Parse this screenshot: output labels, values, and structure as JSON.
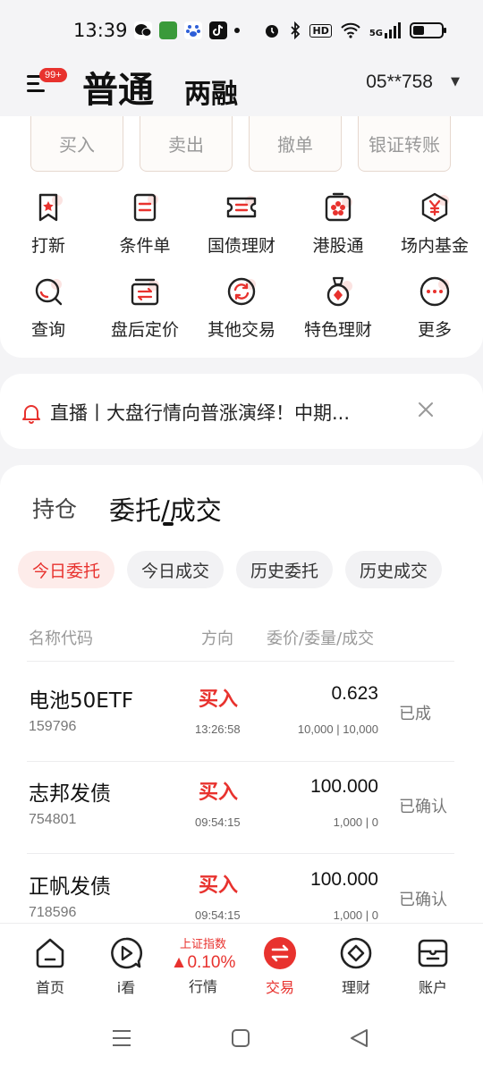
{
  "status_bar": {
    "time": "13:39",
    "network": "5G",
    "hd": "HD"
  },
  "header": {
    "badge": "99+",
    "tab_normal": "普通",
    "tab_margin": "两融",
    "account": "05**758"
  },
  "actions": [
    "买入",
    "卖出",
    "撤单",
    "银证转账"
  ],
  "grid": [
    {
      "label": "打新",
      "icon": "bookmark-star-icon"
    },
    {
      "label": "条件单",
      "icon": "conditional-order-icon"
    },
    {
      "label": "国债理财",
      "icon": "ticket-icon"
    },
    {
      "label": "港股通",
      "icon": "hk-flower-icon"
    },
    {
      "label": "场内基金",
      "icon": "yuan-hexagon-icon"
    },
    {
      "label": "查询",
      "icon": "search-icon"
    },
    {
      "label": "盘后定价",
      "icon": "exchange-card-icon"
    },
    {
      "label": "其他交易",
      "icon": "cycle-icon"
    },
    {
      "label": "特色理财",
      "icon": "medal-icon"
    },
    {
      "label": "更多",
      "icon": "more-icon"
    }
  ],
  "notice": {
    "text": "直播丨大盘行情向普涨演绎！中期..."
  },
  "orders": {
    "tab_position": "持仓",
    "tab_entrust": "委托/成交",
    "chips": [
      "今日委托",
      "今日成交",
      "历史委托",
      "历史成交"
    ],
    "columns": {
      "name": "名称代码",
      "direction": "方向",
      "price": "委价/委量/成交"
    },
    "rows": [
      {
        "name": "电池50ETF",
        "code": "159796",
        "direction": "买入",
        "time": "13:26:58",
        "price": "0.623",
        "qty": "10,000 | 10,000",
        "status": "已成"
      },
      {
        "name": "志邦发债",
        "code": "754801",
        "direction": "买入",
        "time": "09:54:15",
        "price": "100.000",
        "qty": "1,000 | 0",
        "status": "已确认"
      },
      {
        "name": "正帆发债",
        "code": "718596",
        "direction": "买入",
        "time": "09:54:15",
        "price": "100.000",
        "qty": "1,000 | 0",
        "status": "已确认"
      }
    ]
  },
  "bottom_nav": {
    "home": "首页",
    "watch": "i看",
    "index_name": "上证指数",
    "index_value": "▲0.10%",
    "market": "行情",
    "trade": "交易",
    "wealth": "理财",
    "account": "账户"
  },
  "colors": {
    "accent": "#e8322e",
    "bg": "#f4f4f6"
  }
}
